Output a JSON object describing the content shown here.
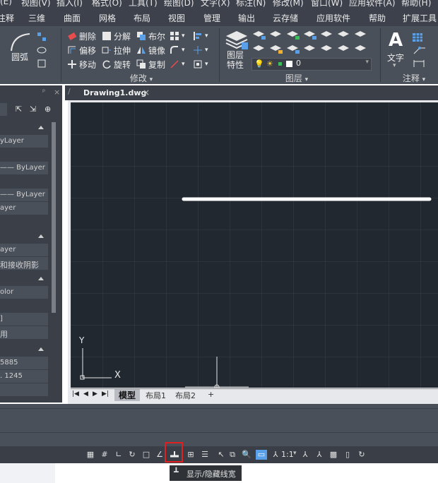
{
  "menu": {
    "items": [
      "(E)",
      "视图(V)",
      "插入(I)",
      "格式(O)",
      "工具(T)",
      "绘图(D)",
      "文字(X)",
      "标注(N)",
      "修改(M)",
      "窗口(W)",
      "应用软件(A)",
      "帮助(H)"
    ]
  },
  "ribbon_tabs": [
    "注释",
    "三维",
    "曲面",
    "网格",
    "布局",
    "视图",
    "管理",
    "输出",
    "云存储",
    "应用软件",
    "帮助",
    "扩展工具"
  ],
  "ribbon": {
    "arc_label": "圆弧",
    "modify": {
      "delete": "删除",
      "explode": "分解",
      "boolean": "布尔",
      "offset": "偏移",
      "stretch": "拉伸",
      "mirror": "镜像",
      "move": "移动",
      "rotate": "旋转",
      "copy": "复制",
      "title": "修改"
    },
    "layers": {
      "props": "图层特性",
      "current_layer": "0",
      "title": "图层"
    },
    "annotation": {
      "text": "文字",
      "title": "注释"
    }
  },
  "left_panel": {
    "rows": [
      "yLayer",
      "—— ByLayer",
      "—— ByLayer",
      "ayer",
      "ayer",
      "和接收阴影",
      "olor",
      "]",
      "用",
      "5885",
      ". 1245"
    ]
  },
  "document": {
    "tab_name": "Drawing1.dwg"
  },
  "canvas": {
    "ucs_x": "X",
    "ucs_y": "Y"
  },
  "layout_tabs": [
    "模型",
    "布局1",
    "布局2",
    "+"
  ],
  "statusbar": {
    "scale": "1:1"
  },
  "tooltip": {
    "text": "显示/隐藏线宽"
  },
  "colors": {
    "canvas_bg": "#212830",
    "ui_dark": "#3b4048",
    "highlight": "#e02020"
  }
}
